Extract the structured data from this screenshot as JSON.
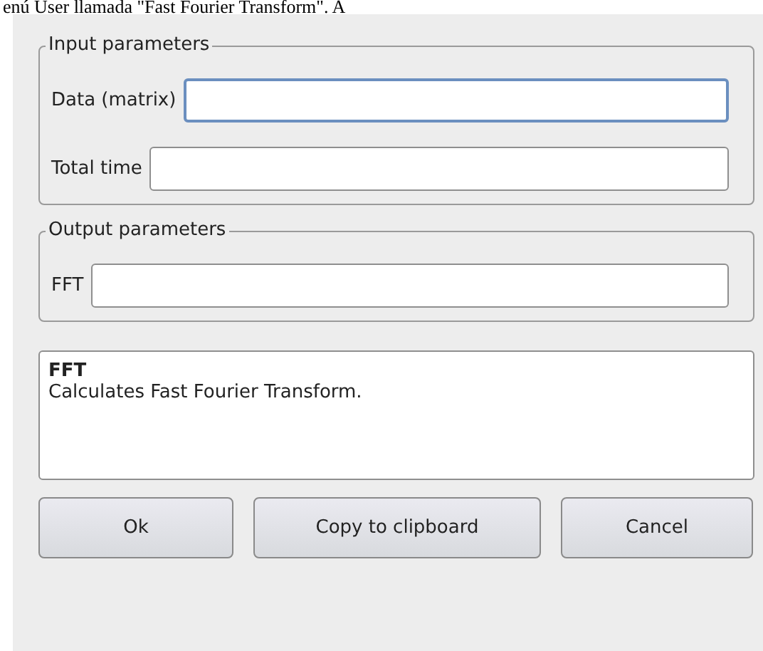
{
  "caption": "enú User llamada \"Fast Fourier Transform\". A",
  "groups": [
    {
      "title": "Input parameters",
      "fields": [
        {
          "label": "Data (matrix)",
          "focused": true
        },
        {
          "label": "Total time",
          "focused": false
        }
      ]
    },
    {
      "title": "Output parameters",
      "fields": [
        {
          "label": "FFT",
          "focused": false
        }
      ]
    }
  ],
  "description": {
    "title": "FFT",
    "text": "Calculates Fast Fourier Transform."
  },
  "buttons": [
    "Ok",
    "Copy to clipboard",
    "Cancel"
  ]
}
